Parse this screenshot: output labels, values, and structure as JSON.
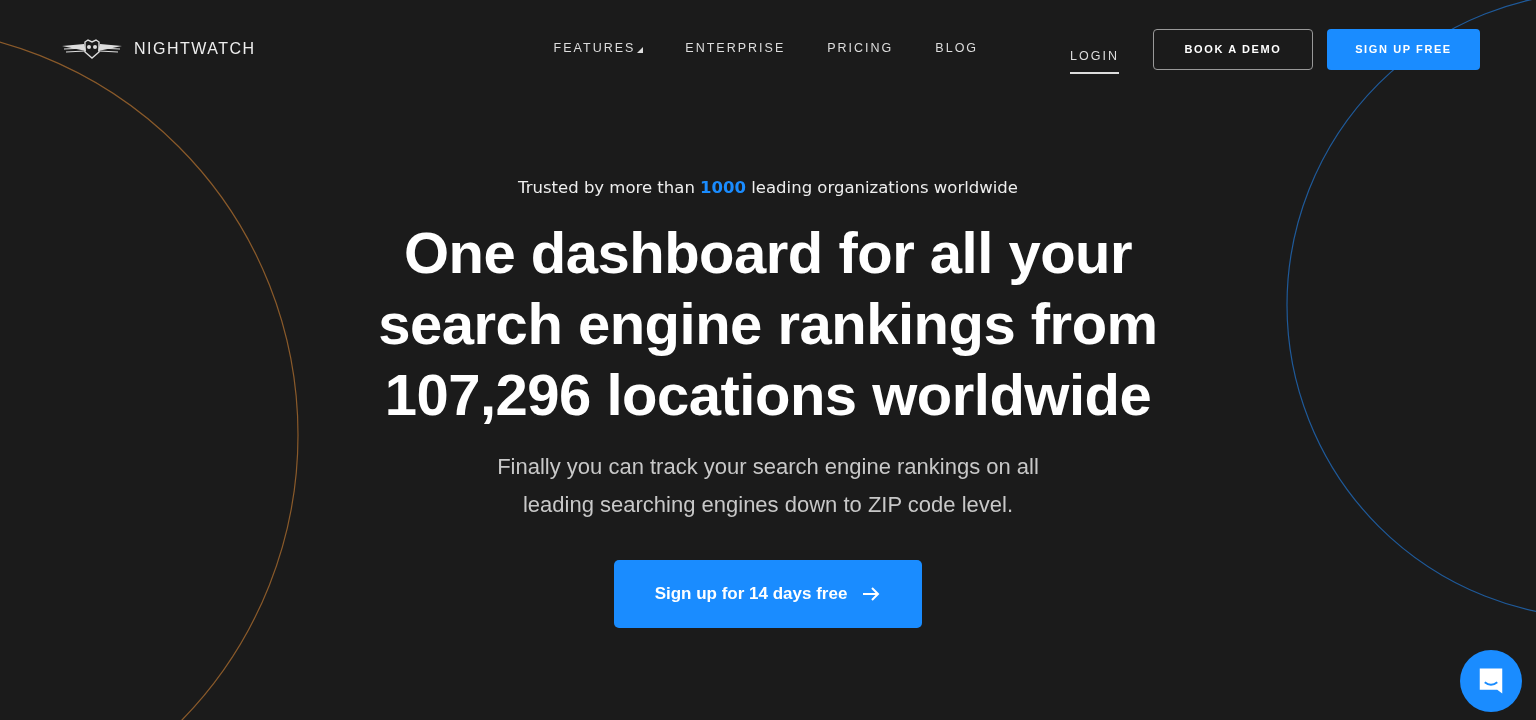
{
  "brand": {
    "name": "NIGHTWATCH"
  },
  "nav": [
    {
      "label": "FEATURES",
      "dropdown": true,
      "selected": false
    },
    {
      "label": "ENTERPRISE",
      "dropdown": false,
      "selected": false
    },
    {
      "label": "PRICING",
      "dropdown": false,
      "selected": false
    },
    {
      "label": "BLOG",
      "dropdown": false,
      "selected": false
    },
    {
      "label": "LOGIN",
      "dropdown": false,
      "selected": true
    }
  ],
  "buttons": [
    {
      "label": "BOOK A DEMO",
      "kind": "outline"
    },
    {
      "label": "SIGN UP FREE",
      "kind": "primary"
    }
  ],
  "hero": {
    "tagline": "Trusted by more than **1000** leading organizations worldwide",
    "headline": [
      "One dashboard for all your",
      "search engine rankings from",
      "107,296 locations worldwide"
    ],
    "subtitle": [
      "Finally you can track your search engine rankings on all",
      "leading searching engines down to ZIP code level."
    ],
    "cta": "Sign up for 14 days free"
  }
}
